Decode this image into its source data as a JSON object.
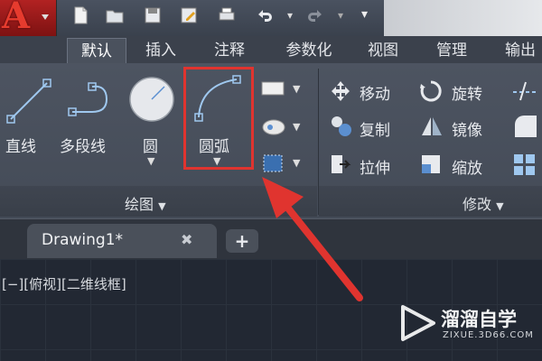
{
  "app": {
    "logo_letter": "A",
    "accent": "#d42a22"
  },
  "quick_access": {
    "icons": [
      "new-file-icon",
      "open-folder-icon",
      "save-icon",
      "save-as-icon",
      "print-icon",
      "undo-icon",
      "redo-icon",
      "dropdown-icon"
    ]
  },
  "tabs": [
    {
      "label": "默认",
      "active": true
    },
    {
      "label": "插入"
    },
    {
      "label": "注释"
    },
    {
      "label": "参数化"
    },
    {
      "label": "视图"
    },
    {
      "label": "管理"
    },
    {
      "label": "输出"
    }
  ],
  "draw_panel": {
    "title": "绘图",
    "tools": {
      "line": "直线",
      "polyline": "多段线",
      "circle": "圆",
      "arc": "圆弧"
    }
  },
  "modify_panel": {
    "title": "修改",
    "tools": {
      "move": "移动",
      "rotate": "旋转",
      "copy": "复制",
      "mirror": "镜像",
      "stretch": "拉伸",
      "scale": "缩放"
    }
  },
  "file_tab": {
    "name": "Drawing1*",
    "close": "✖",
    "new": "+"
  },
  "viewport": {
    "label": "[−][俯视][二维线框]"
  },
  "watermark": {
    "name": "溜溜自学",
    "url": "ZIXUE.3D66.COM"
  },
  "colors": {
    "highlight": "#e0342f",
    "arrow": "#e0342f"
  }
}
